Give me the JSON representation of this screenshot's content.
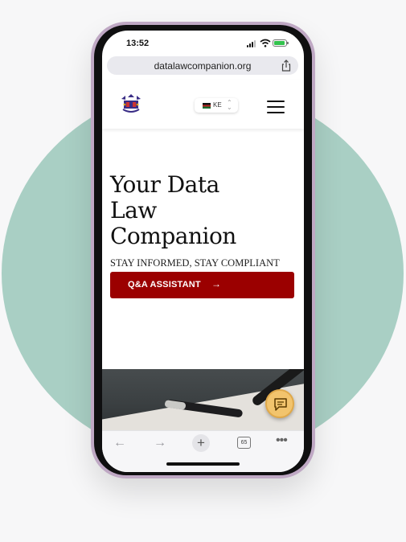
{
  "status_bar": {
    "time": "13:52"
  },
  "browser": {
    "url": "datalawcompanion.org",
    "tab_count": "65"
  },
  "header": {
    "country_code": "KE"
  },
  "hero": {
    "title_lines": [
      "Your Data",
      "Law",
      "Companion"
    ],
    "subtitle": "STAY INFORMED, STAY COMPLIANT",
    "cta_label": "Q&A ASSISTANT",
    "cta_arrow": "→"
  },
  "toolbar": {
    "back": "←",
    "forward": "→",
    "new_tab": "+",
    "more": "•••"
  },
  "colors": {
    "accent": "#9b0000",
    "backdrop_circle": "#a9cfc4",
    "phone_frame": "#bfa8c4",
    "chat_button": "#f2c46d"
  },
  "icons": [
    "share-icon",
    "logo-icon",
    "flag-icon",
    "chevron-updown-icon",
    "hamburger-icon",
    "arrow-right-icon",
    "chat-icon",
    "back-icon",
    "forward-icon",
    "plus-icon",
    "tabs-icon",
    "more-icon"
  ]
}
